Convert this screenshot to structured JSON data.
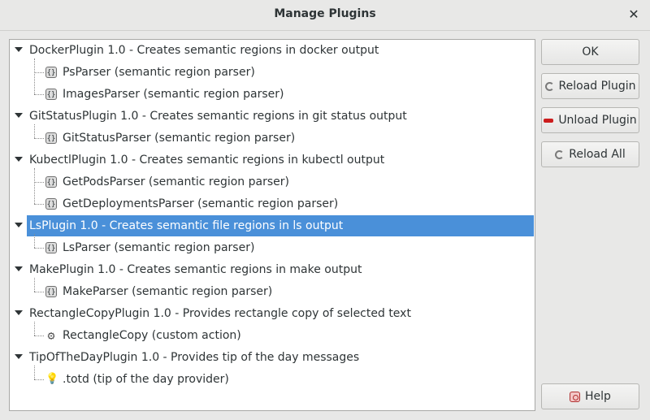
{
  "window": {
    "title": "Manage Plugins",
    "close_icon": "close-icon"
  },
  "plugins": [
    {
      "label": "DockerPlugin 1.0 - Creates semantic regions in docker output",
      "children": [
        {
          "label": "PsParser (semantic region parser)",
          "icon": "parser-icon"
        },
        {
          "label": "ImagesParser (semantic region parser)",
          "icon": "parser-icon"
        }
      ]
    },
    {
      "label": "GitStatusPlugin 1.0 - Creates semantic regions in git status output",
      "children": [
        {
          "label": "GitStatusParser (semantic region parser)",
          "icon": "parser-icon"
        }
      ]
    },
    {
      "label": "KubectlPlugin 1.0 - Creates semantic regions in kubectl output",
      "children": [
        {
          "label": "GetPodsParser (semantic region parser)",
          "icon": "parser-icon"
        },
        {
          "label": "GetDeploymentsParser (semantic region parser)",
          "icon": "parser-icon"
        }
      ]
    },
    {
      "label": "LsPlugin 1.0 - Creates semantic file regions in ls output",
      "selected": true,
      "children": [
        {
          "label": "LsParser (semantic region parser)",
          "icon": "parser-icon"
        }
      ]
    },
    {
      "label": "MakePlugin 1.0 - Creates semantic regions in make output",
      "children": [
        {
          "label": "MakeParser (semantic region parser)",
          "icon": "parser-icon"
        }
      ]
    },
    {
      "label": "RectangleCopyPlugin 1.0 - Provides rectangle copy of selected text",
      "children": [
        {
          "label": "RectangleCopy (custom action)",
          "icon": "action-icon"
        }
      ]
    },
    {
      "label": "TipOfTheDayPlugin 1.0 - Provides tip of the day messages",
      "children": [
        {
          "label": ".totd (tip of the day provider)",
          "icon": "lightbulb-icon"
        }
      ]
    }
  ],
  "buttons": {
    "ok": "OK",
    "reload_plugin": "Reload Plugin",
    "unload_plugin": "Unload Plugin",
    "reload_all": "Reload All",
    "help": "Help"
  },
  "colors": {
    "selection": "#4a90d9",
    "background": "#e8e8e7",
    "unload_icon": "#cc1d1d"
  }
}
